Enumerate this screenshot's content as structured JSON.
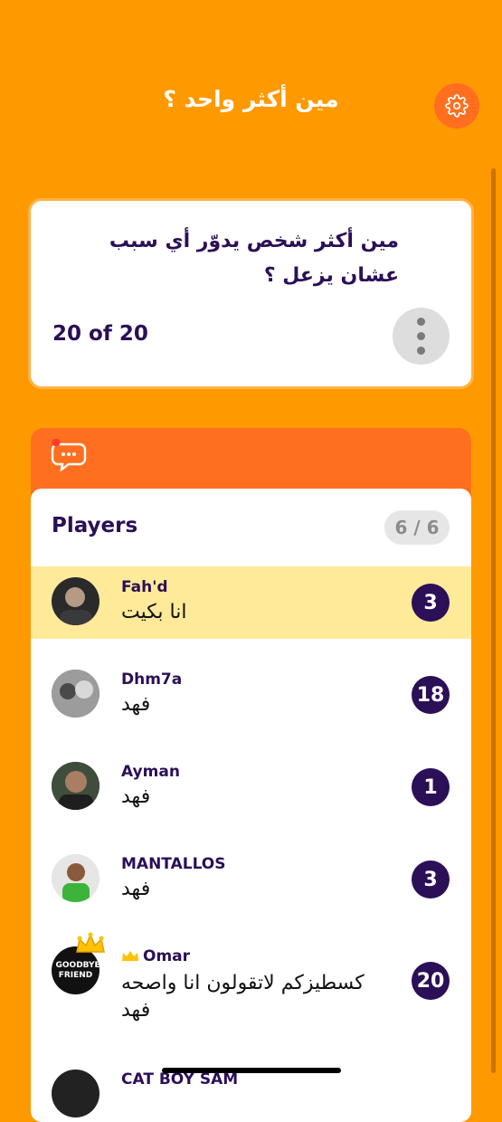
{
  "header": {
    "title": "مين أكثر واحد ؟",
    "settings_icon": "gear-icon"
  },
  "question": {
    "text": "مين أكثر شخص يدوّر أي سبب عشان يزعل ؟",
    "counter": "20 of 20",
    "more_icon": "more-vertical-icon"
  },
  "chat": {
    "icon": "chat-bubble-icon",
    "badge_color": "#FF3B30"
  },
  "players": {
    "title": "Players",
    "count": "6 / 6",
    "items": [
      {
        "name": "Fah'd",
        "answer": "انا بكيت",
        "score": "3"
      },
      {
        "name": "Dhm7a",
        "answer": "فهد",
        "score": "18"
      },
      {
        "name": "Ayman",
        "answer": "فهد",
        "score": "1"
      },
      {
        "name": "MANTALLOS",
        "answer": "فهد",
        "score": "3"
      },
      {
        "name": "Omar",
        "answer": "كسطيزكم لاتقولون انا واصحه فهد",
        "score": "20",
        "avatar_text": "GOODBYE, FRIEND",
        "host": true
      },
      {
        "name": "CAT BOY SAM",
        "answer": "",
        "score": ""
      }
    ]
  },
  "colors": {
    "background": "#FF9900",
    "accent": "#FF6F1F",
    "text_dark": "#2B0F57",
    "highlight_row": "#FFEA9A",
    "crown": "#FFC107"
  }
}
